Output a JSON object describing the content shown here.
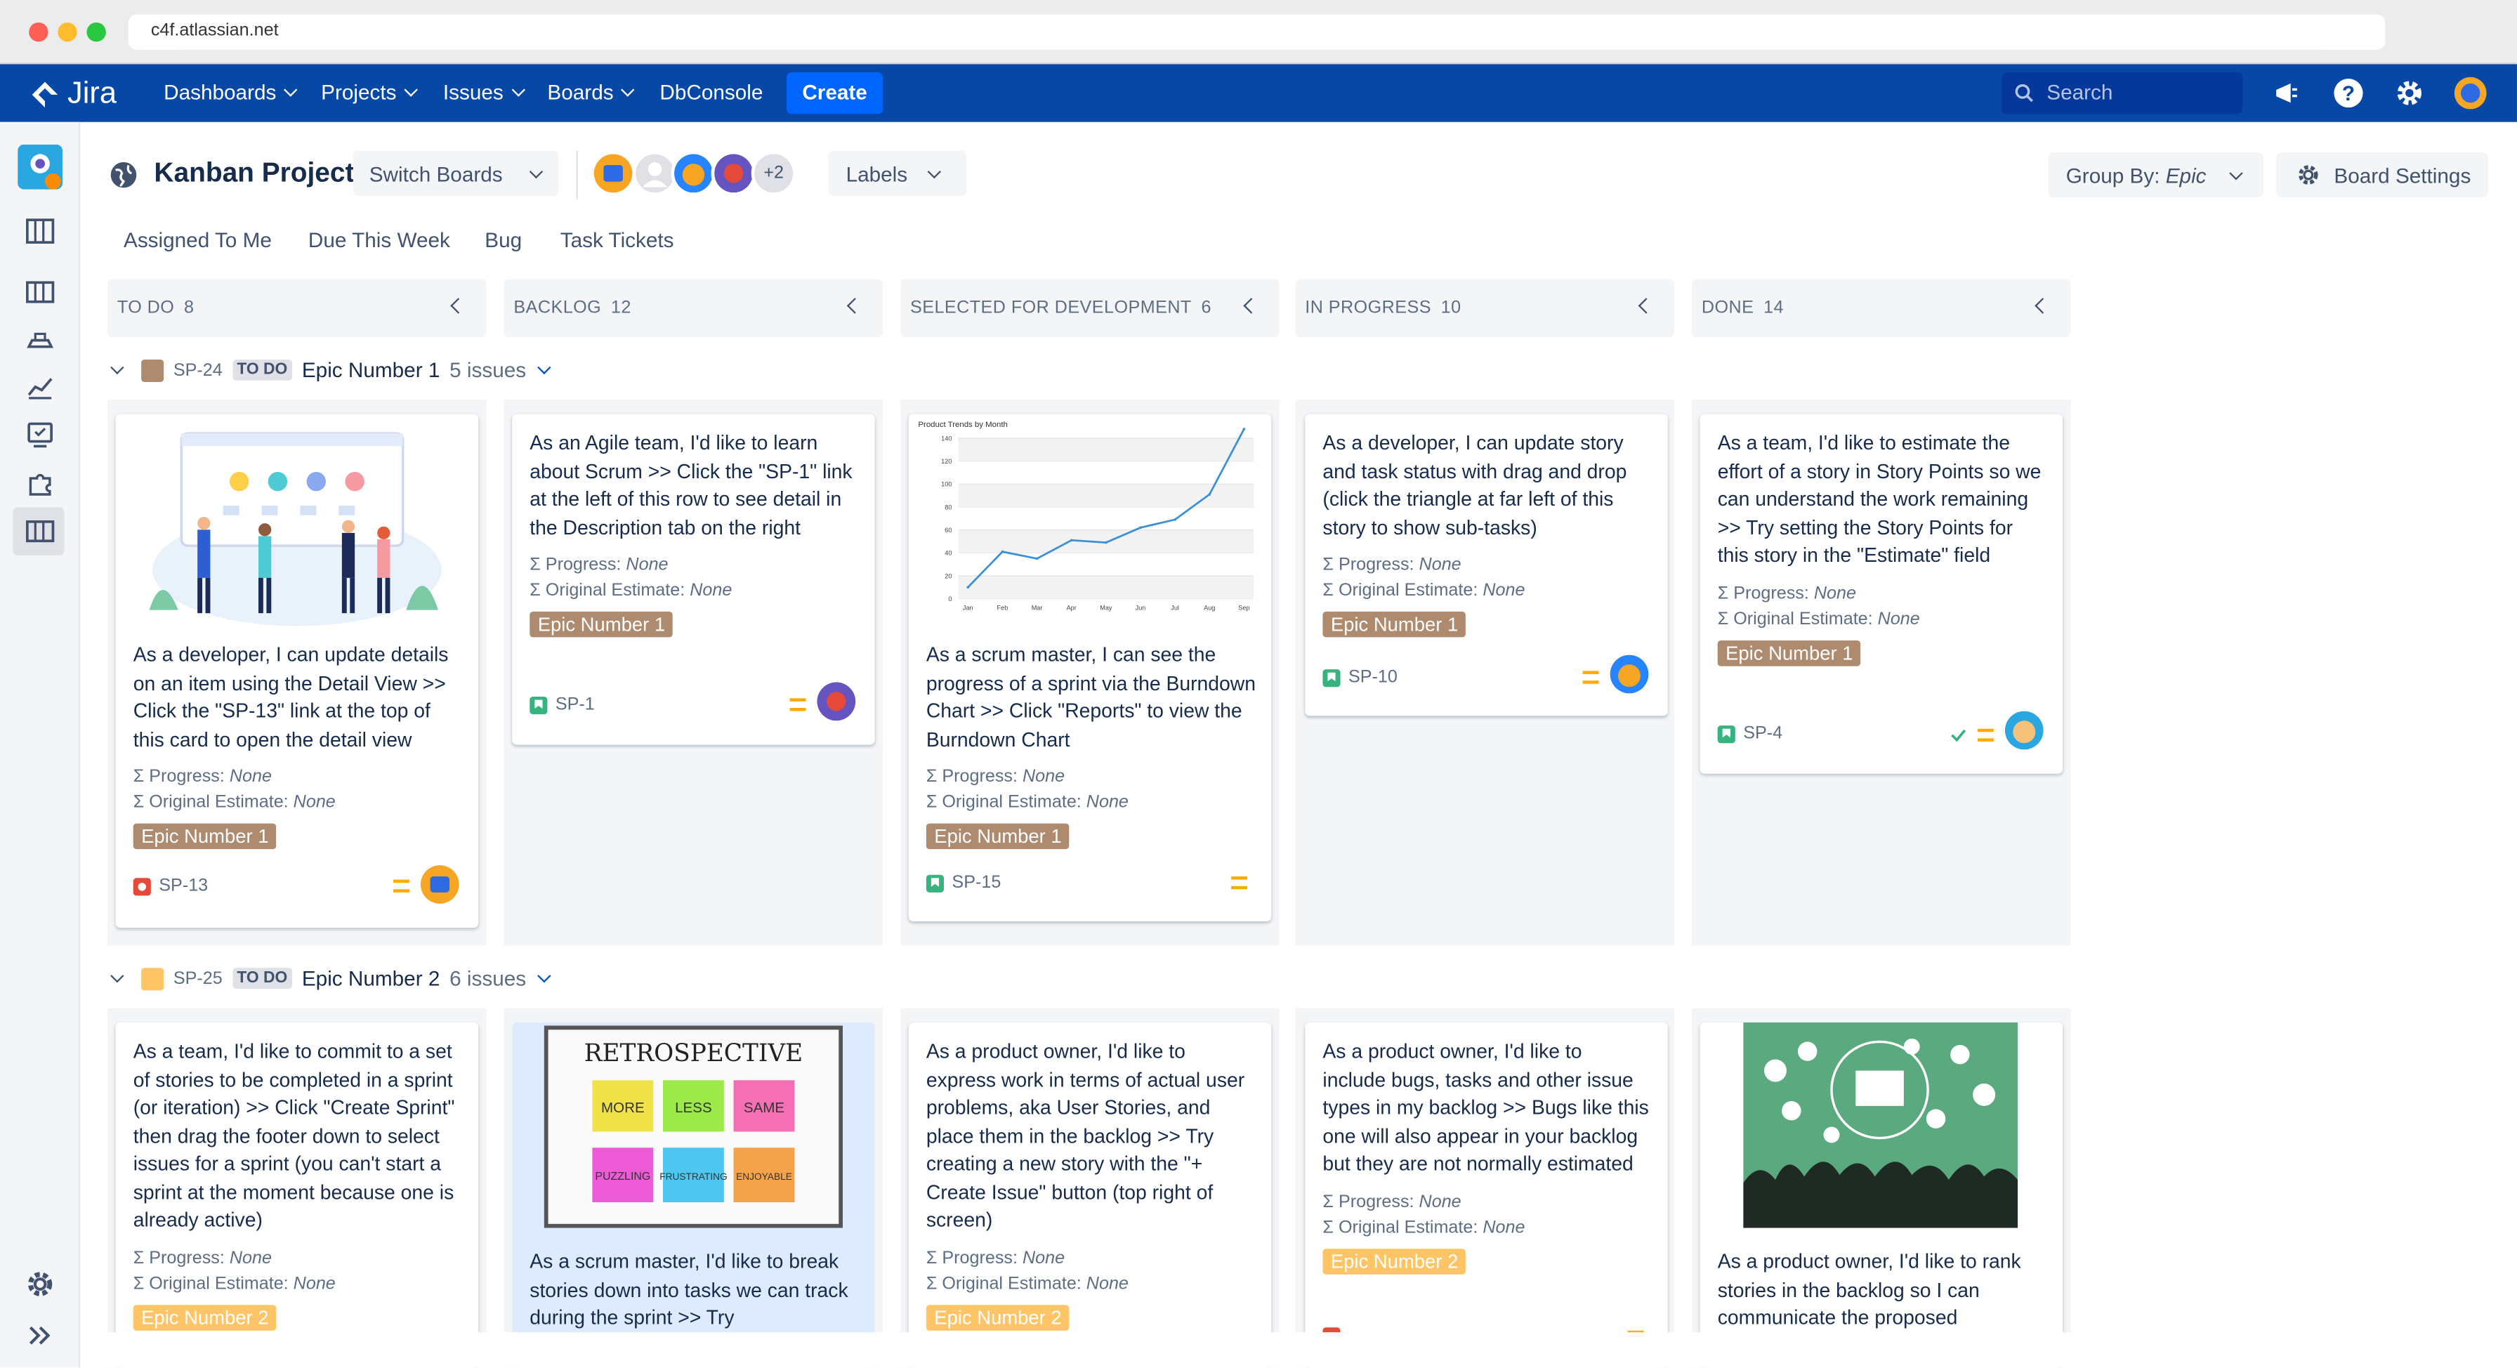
{
  "browser": {
    "url": "c4f.atlassian.net"
  },
  "nav": {
    "logo": "Jira",
    "items": [
      "Dashboards",
      "Projects",
      "Issues",
      "Boards",
      "DbConsole"
    ],
    "create": "Create",
    "search_placeholder": "Search",
    "colors": {
      "bar": "#0747a6",
      "create": "#0065ff"
    }
  },
  "header": {
    "project": "Kanban Project",
    "switch_boards": "Switch Boards",
    "more_avatars": "+2",
    "labels": "Labels",
    "group_by_prefix": "Group By: ",
    "group_by_value": "Epic",
    "board_settings": "Board Settings"
  },
  "quick_filters": [
    "Assigned To Me",
    "Due This Week",
    "Bug",
    "Task Tickets"
  ],
  "columns": [
    {
      "name": "TO DO",
      "count": "8"
    },
    {
      "name": "BACKLOG",
      "count": "12"
    },
    {
      "name": "SELECTED FOR DEVELOPMENT",
      "count": "6"
    },
    {
      "name": "IN PROGRESS",
      "count": "10"
    },
    {
      "name": "DONE",
      "count": "14"
    }
  ],
  "swimlanes": [
    {
      "key": "SP-24",
      "status": "TO DO",
      "name": "Epic Number 1",
      "count": "5 issues",
      "color": "#ae8a6f"
    },
    {
      "key": "SP-25",
      "status": "TO DO",
      "name": "Epic Number 2",
      "count": "6 issues",
      "color": "#ffc466"
    }
  ],
  "labels": {
    "progress": "Σ Progress:",
    "estimate": "Σ Original Estimate:",
    "none": "None"
  },
  "cards": {
    "sp13": {
      "summary": "As a developer, I can update details on an item using the Detail View >> Click the \"SP-13\" link at the top of this card to open the detail view",
      "epic": "Epic Number 1",
      "key": "SP-13"
    },
    "sp1": {
      "summary": "As an Agile team, I'd like to learn about Scrum >> Click the \"SP-1\" link at the left of this row to see detail in the Description tab on the right",
      "epic": "Epic Number 1",
      "key": "SP-1"
    },
    "sp15": {
      "summary": "As a scrum master, I can see the progress of a sprint via the Burndown Chart >> Click \"Reports\" to view the Burndown Chart",
      "epic": "Epic Number 1",
      "key": "SP-15",
      "chart_title": "Product Trends by Month"
    },
    "sp10": {
      "summary": "As a developer, I can update story and task status with drag and drop (click the triangle at far left of this story to show sub-tasks)",
      "epic": "Epic Number 1",
      "key": "SP-10"
    },
    "sp4": {
      "summary": "As a team, I'd like to estimate the effort of a story in Story Points so we can understand the work remaining >> Try setting the Story Points for this story in the \"Estimate\" field",
      "epic": "Epic Number 1",
      "key": "SP-4"
    },
    "e2a": {
      "summary": "As a team, I'd like to commit to a set of stories to be completed in a sprint (or iteration) >> Click \"Create Sprint\" then drag the footer down to select issues for a sprint (you can't start a sprint at the moment because one is already active)",
      "epic": "Epic Number 2"
    },
    "e2b": {
      "summary": "As a scrum master, I'd like to break stories down into tasks we can track during the sprint >> Try",
      "board_title": "RETROSPECTIVE",
      "notes": [
        "MORE",
        "LESS",
        "SAME",
        "PUZZLING",
        "FRUSTRATING",
        "ENJOYABLE"
      ]
    },
    "e2c": {
      "summary": "As a product owner, I'd like to express work in terms of actual user problems, aka User Stories, and place them in the backlog >> Try creating a new story with the \"+ Create Issue\" button (top right of screen)",
      "epic": "Epic Number 2"
    },
    "e2d": {
      "summary": "As a product owner, I'd like to include bugs, tasks and other issue types in my backlog >> Bugs like this one will also appear in your backlog but they are not normally estimated",
      "epic": "Epic Number 2"
    },
    "e2e": {
      "summary": "As a product owner, I'd like to rank stories in the backlog so I can communicate the proposed"
    }
  },
  "chart_data": {
    "type": "line",
    "title": "Product Trends by Month",
    "categories": [
      "Jan",
      "Feb",
      "Mar",
      "Apr",
      "May",
      "Jun",
      "Jul",
      "Aug",
      "Sep"
    ],
    "values": [
      10,
      41,
      35,
      51,
      49,
      62,
      69,
      91,
      148
    ],
    "ylim": [
      0,
      140
    ],
    "yticks": [
      0,
      20,
      40,
      60,
      80,
      100,
      120,
      140
    ],
    "color": "#3b8fd9"
  }
}
